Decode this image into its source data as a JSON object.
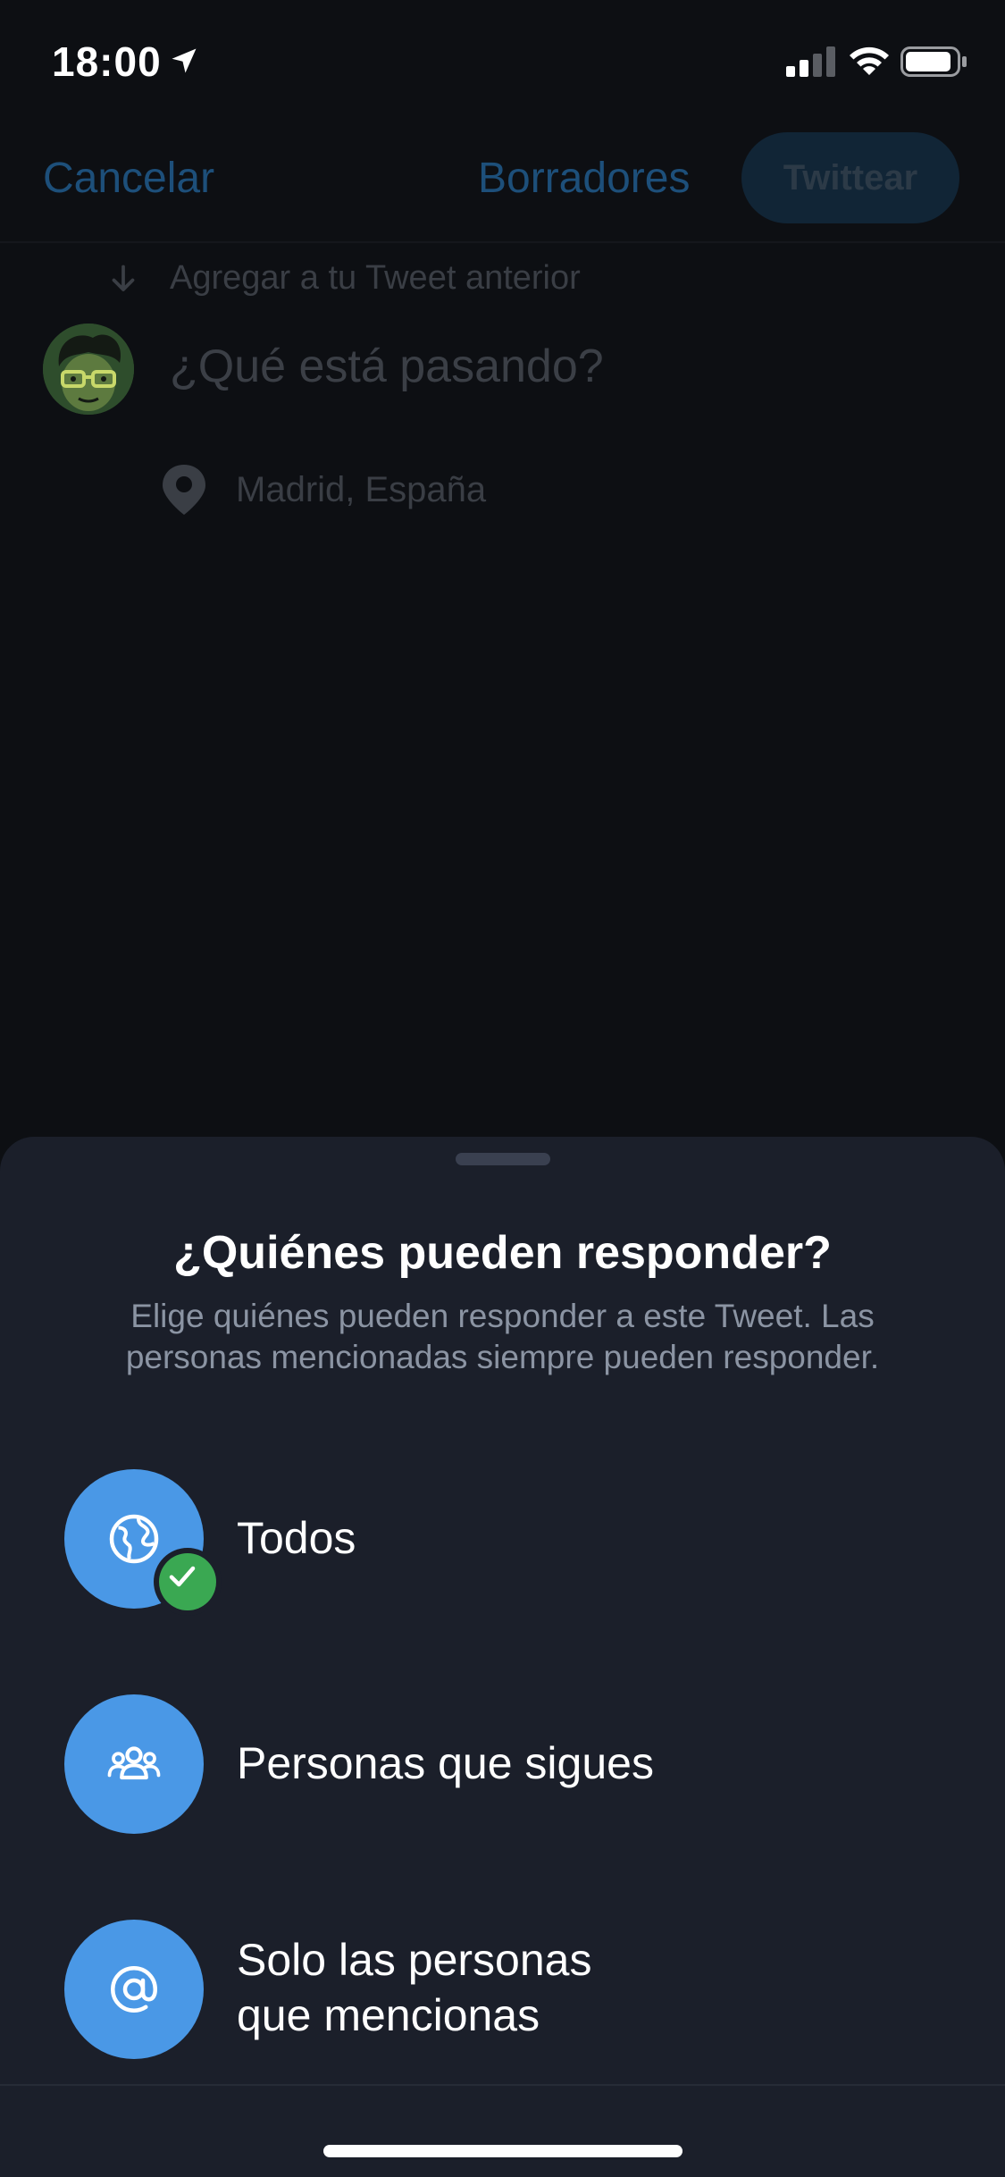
{
  "status_bar": {
    "time": "18:00"
  },
  "compose": {
    "cancel_label": "Cancelar",
    "drafts_label": "Borradores",
    "tweet_label": "Twittear",
    "add_to_previous": "Agregar a tu Tweet anterior",
    "placeholder": "¿Qué está pasando?",
    "location": "Madrid, España"
  },
  "sheet": {
    "title": "¿Quiénes pueden responder?",
    "subtitle_line1": "Elige quiénes pueden responder a este Tweet. Las",
    "subtitle_line2": "personas mencionadas siempre pueden responder.",
    "options": [
      {
        "label": "Todos",
        "icon": "globe-icon",
        "selected": true
      },
      {
        "label": "Personas que sigues",
        "icon": "people-icon",
        "selected": false
      },
      {
        "label_line1": "Solo las personas",
        "label_line2": "que mencionas",
        "icon": "at-icon",
        "selected": false
      }
    ]
  },
  "colors": {
    "accent": "#4a98e6",
    "check": "#3aa852",
    "sheet_background": "#1b1f2a"
  }
}
